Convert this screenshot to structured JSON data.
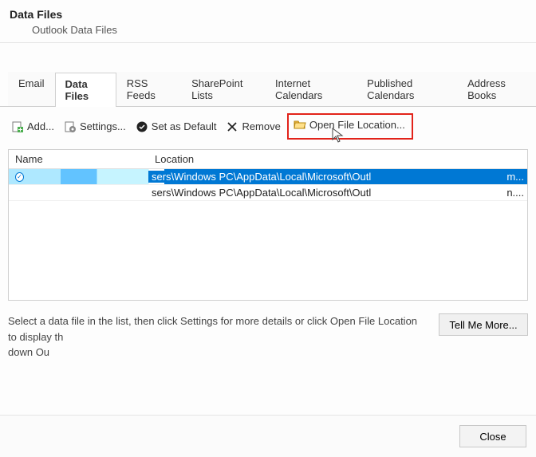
{
  "header": {
    "title": "Data Files",
    "subtitle": "Outlook Data Files"
  },
  "tabs": [
    {
      "label": "Email",
      "active": false
    },
    {
      "label": "Data Files",
      "active": true
    },
    {
      "label": "RSS Feeds",
      "active": false
    },
    {
      "label": "SharePoint Lists",
      "active": false
    },
    {
      "label": "Internet Calendars",
      "active": false
    },
    {
      "label": "Published Calendars",
      "active": false
    },
    {
      "label": "Address Books",
      "active": false
    }
  ],
  "toolbar": {
    "add": "Add...",
    "settings": "Settings...",
    "set_default": "Set as Default",
    "remove": "Remove",
    "open_location": "Open File Location..."
  },
  "columns": {
    "name": "Name",
    "location": "Location"
  },
  "rows": [
    {
      "checked": true,
      "selected": true,
      "location_visible": "sers\\Windows PC\\AppData\\Local\\Microsoft\\Outl",
      "location_suffix": "m..."
    },
    {
      "checked": false,
      "selected": false,
      "location_visible": "sers\\Windows PC\\AppData\\Local\\Microsoft\\Outl",
      "location_suffix": "n...."
    }
  ],
  "help_text": "Select a data file in the list, then click Settings for more details or click Open File Location to display th\ndown Ou",
  "tell_more": "Tell Me More...",
  "close": "Close"
}
